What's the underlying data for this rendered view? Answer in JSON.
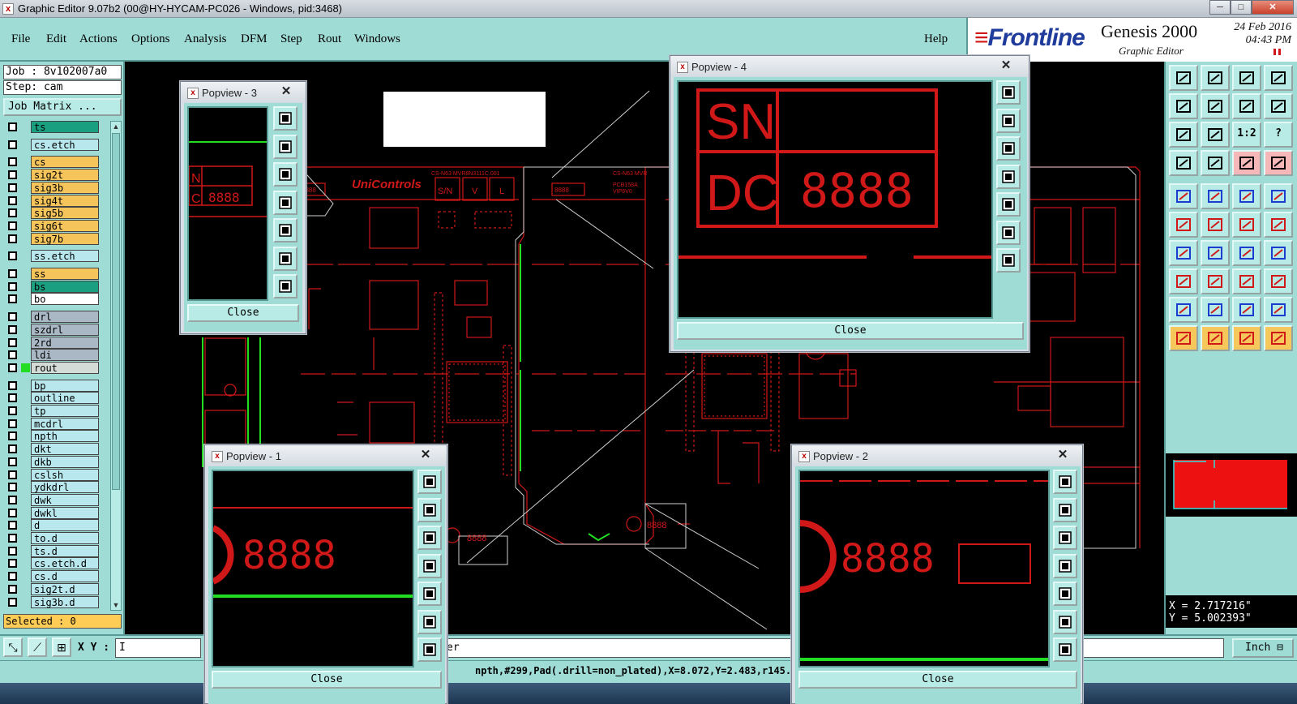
{
  "titlebar": {
    "title": "Graphic Editor 9.07b2 (00@HY-HYCAM-PC026 - Windows, pid:3468)",
    "min": "─",
    "max": "□",
    "close": "✕"
  },
  "menu": {
    "file": "File",
    "edit": "Edit",
    "actions": "Actions",
    "options": "Options",
    "analysis": "Analysis",
    "dfm": "DFM",
    "step": "Step",
    "rout": "Rout",
    "windows": "Windows",
    "help": "Help"
  },
  "brand": {
    "logo_mark": "≡",
    "logo": "Frontline",
    "product": "Genesis 2000",
    "subtitle": "Graphic Editor",
    "date": "24 Feb 2016",
    "time": "04:43 PM"
  },
  "job": {
    "job": "Job : 8v102007a0",
    "step": "Step: cam",
    "matrix": "Job Matrix ..."
  },
  "layers": [
    {
      "name": "ts",
      "color": "#1aa080",
      "box": "#1aa080"
    },
    {
      "name": "cs.etch",
      "color": "#b8e8ee",
      "box": "#b8e8ee"
    },
    {
      "name": "cs",
      "color": "#f5c45a",
      "box": "#f5c45a"
    },
    {
      "name": "sig2t",
      "color": "#f5c45a",
      "box": "#f5c45a"
    },
    {
      "name": "sig3b",
      "color": "#f5c45a",
      "box": "#f5c45a"
    },
    {
      "name": "sig4t",
      "color": "#f5c45a",
      "box": "#f5c45a"
    },
    {
      "name": "sig5b",
      "color": "#f5c45a",
      "box": "#f5c45a"
    },
    {
      "name": "sig6t",
      "color": "#f5c45a",
      "box": "#f5c45a"
    },
    {
      "name": "sig7b",
      "color": "#f5c45a",
      "box": "#f5c45a"
    },
    {
      "name": "ss.etch",
      "color": "#b8e8ee",
      "box": "#b8e8ee"
    },
    {
      "name": "ss",
      "color": "#f5c45a",
      "box": "#f5c45a"
    },
    {
      "name": "bs",
      "color": "#1aa080",
      "box": "#1aa080"
    },
    {
      "name": "bo",
      "color": "#ffffff",
      "box": "#ffffff"
    },
    {
      "name": "drl",
      "color": "#a9b8c4",
      "box": "#a9b8c4"
    },
    {
      "name": "szdrl",
      "color": "#a9b8c4",
      "box": "#a9b8c4"
    },
    {
      "name": "2rd",
      "color": "#a9b8c4",
      "box": "#a9b8c4"
    },
    {
      "name": "ldi",
      "color": "#a9b8c4",
      "box": "#a9b8c4"
    },
    {
      "name": "rout",
      "color": "#d4dcd8",
      "box": "#22dd22"
    },
    {
      "name": "bp",
      "color": "#b8e8ee",
      "box": "#b8e8ee"
    },
    {
      "name": "outline",
      "color": "#b8e8ee",
      "box": "#b8e8ee"
    },
    {
      "name": "tp",
      "color": "#b8e8ee",
      "box": "#b8e8ee"
    },
    {
      "name": "mcdrl",
      "color": "#b8e8ee",
      "box": "#b8e8ee"
    },
    {
      "name": "npth",
      "color": "#b8e8ee",
      "box": "#b8e8ee"
    },
    {
      "name": "dkt",
      "color": "#b8e8ee",
      "box": "#b8e8ee"
    },
    {
      "name": "dkb",
      "color": "#b8e8ee",
      "box": "#b8e8ee"
    },
    {
      "name": "cslsh",
      "color": "#b8e8ee",
      "box": "#b8e8ee"
    },
    {
      "name": "ydkdrl",
      "color": "#b8e8ee",
      "box": "#b8e8ee"
    },
    {
      "name": "dwk",
      "color": "#b8e8ee",
      "box": "#b8e8ee"
    },
    {
      "name": "dwkl",
      "color": "#b8e8ee",
      "box": "#b8e8ee"
    },
    {
      "name": "d",
      "color": "#b8e8ee",
      "box": "#b8e8ee"
    },
    {
      "name": "to.d",
      "color": "#b8e8ee",
      "box": "#b8e8ee"
    },
    {
      "name": "ts.d",
      "color": "#b8e8ee",
      "box": "#b8e8ee"
    },
    {
      "name": "cs.etch.d",
      "color": "#b8e8ee",
      "box": "#b8e8ee"
    },
    {
      "name": "cs.d",
      "color": "#b8e8ee",
      "box": "#b8e8ee"
    },
    {
      "name": "sig2t.d",
      "color": "#b8e8ee",
      "box": "#b8e8ee"
    },
    {
      "name": "sig3b.d",
      "color": "#b8e8ee",
      "box": "#b8e8ee"
    }
  ],
  "selected": "Selected : 0",
  "xy": {
    "label": "X Y :",
    "value": "I",
    "message": "er",
    "unit": "Inch ⊟"
  },
  "status": "npth,#299,Pad(.drill=non_plated),X=8.072,Y=2.483,r145.6",
  "coords": {
    "x": "X = 2.717216\"",
    "y": "Y = 5.002393\""
  },
  "canvas": {
    "brand": "UniControls",
    "sn": "S/N",
    "v": "V",
    "l": "L",
    "code1": "CS-N63 MVR8N3111C.001",
    "code2": "CS-N63 MVR",
    "digits": "8888",
    "label1": "PCB158A",
    "label2": "VIP8V0"
  },
  "popups": {
    "p1": {
      "title": "Popview - 1",
      "close": "Close",
      "x": "✕",
      "digits": "8888"
    },
    "p2": {
      "title": "Popview - 2",
      "close": "Close",
      "x": "✕",
      "digits": "8888"
    },
    "p3": {
      "title": "Popview - 3",
      "close": "Close",
      "x": "✕",
      "n": "N",
      "c": "C",
      "digits": "8888"
    },
    "p4": {
      "title": "Popview - 4",
      "close": "Close",
      "x": "✕",
      "sn": "SN",
      "dc": "DC",
      "digits": "8888"
    }
  },
  "right_tools": {
    "ratio": "1:2",
    "help": "?"
  },
  "colors": {
    "panel": "#9fdcd6",
    "board_line": "#d01818",
    "highlight": "#f6c75a",
    "green_line": "#22dd22"
  }
}
